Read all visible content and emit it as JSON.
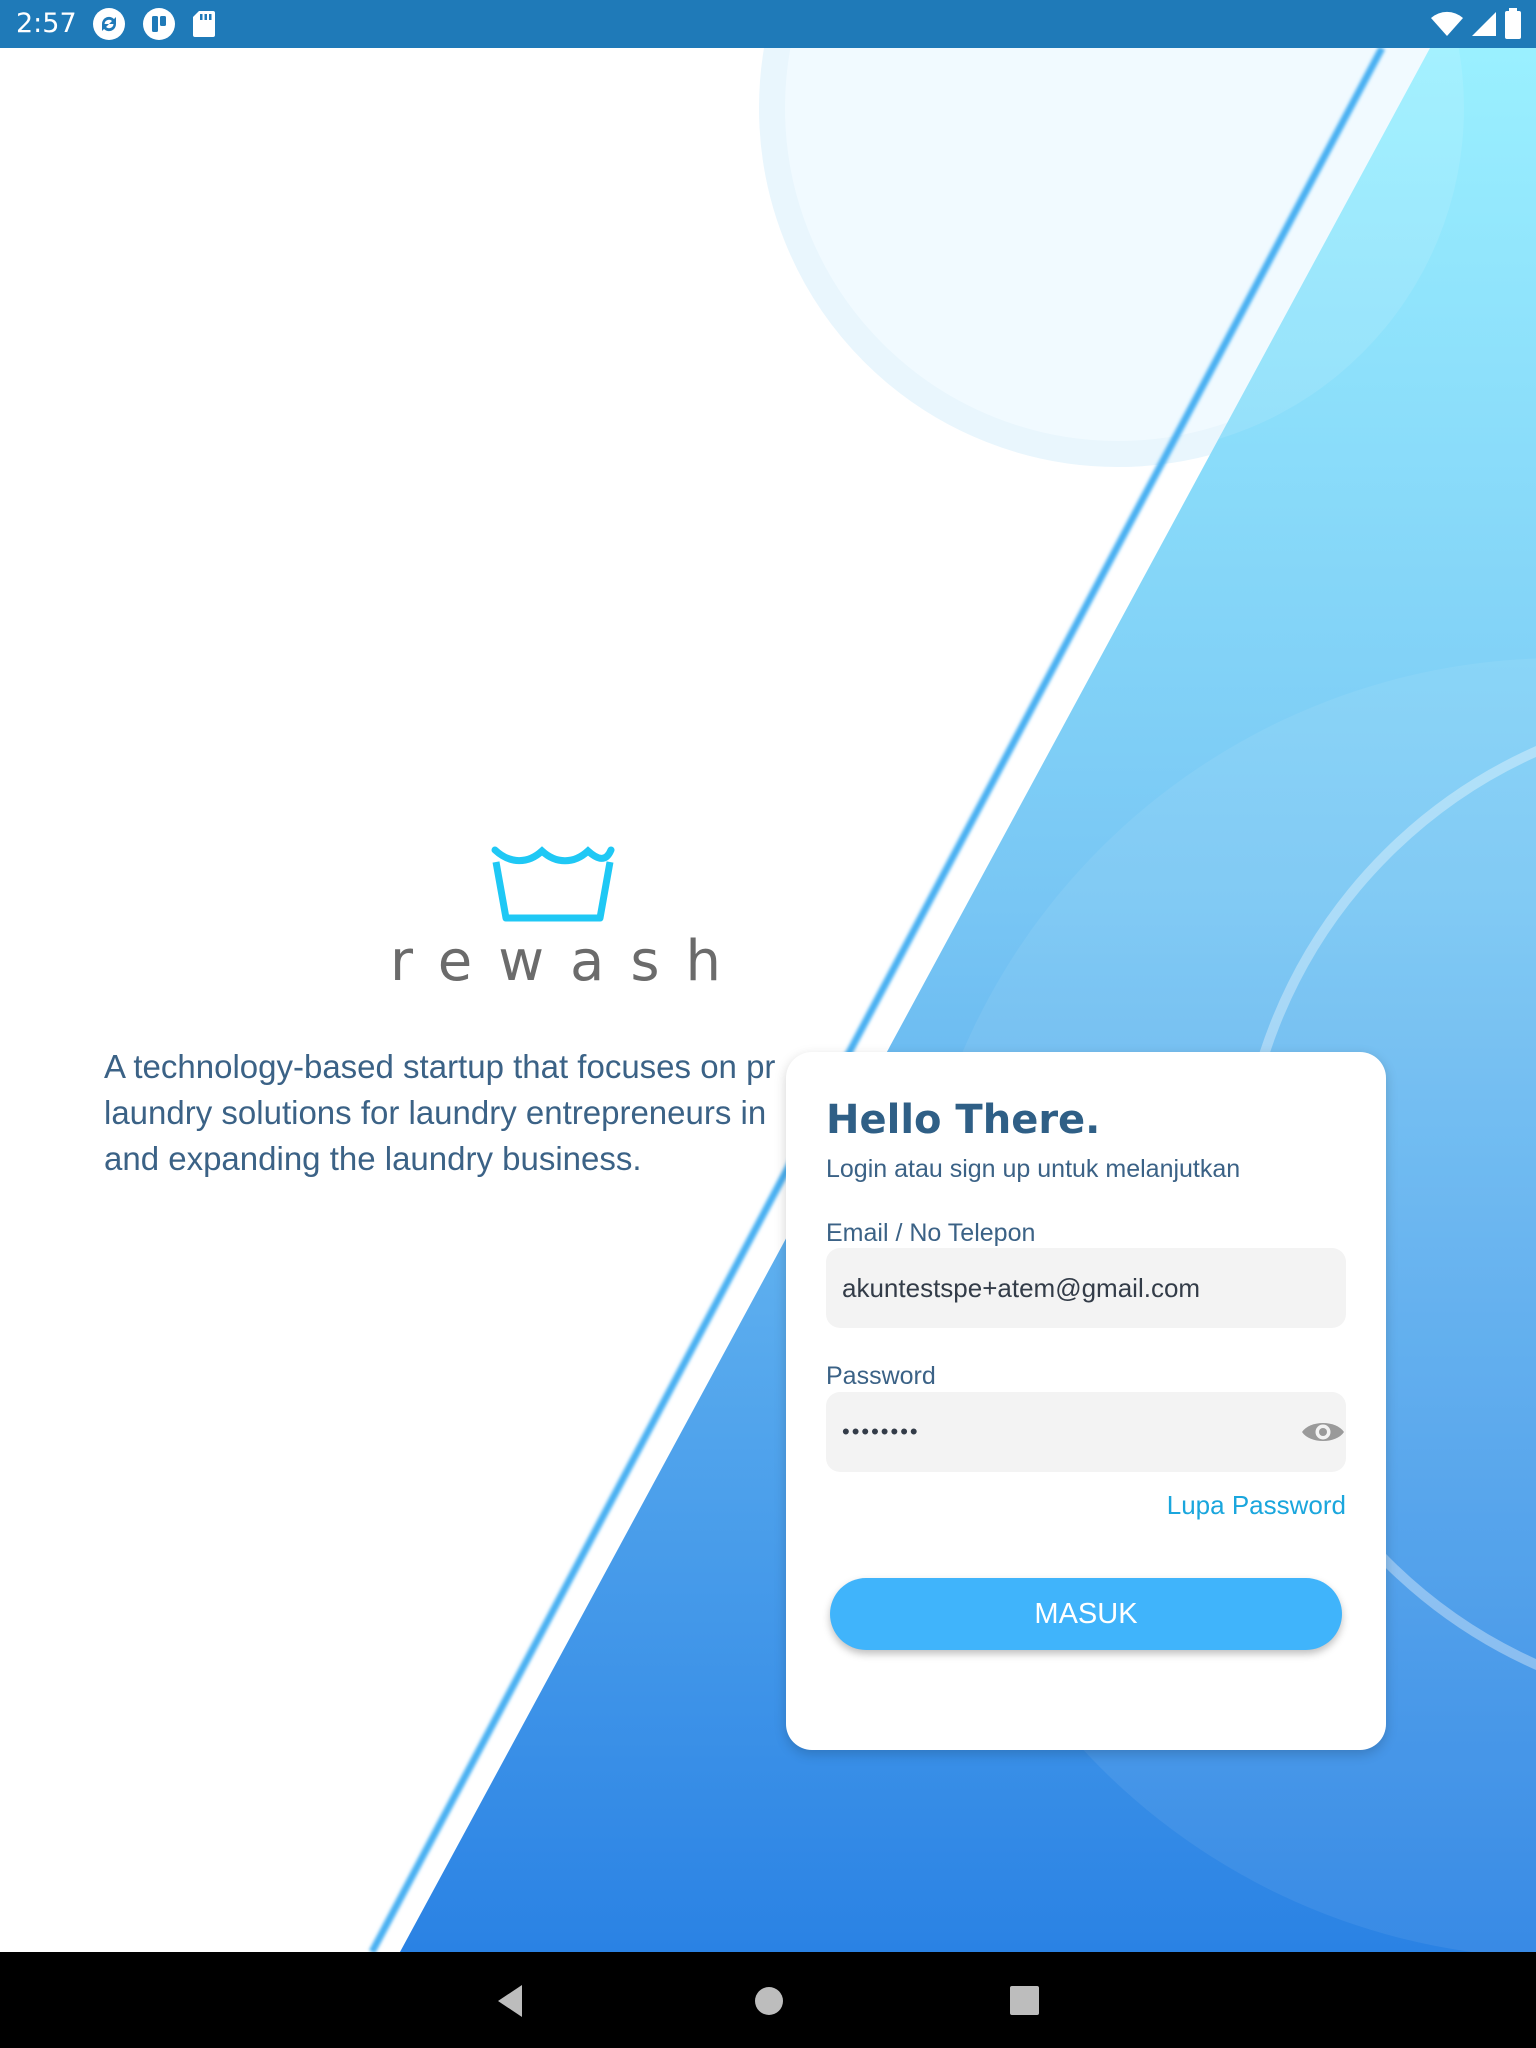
{
  "status_bar": {
    "time": "2:57",
    "left_icons": [
      "sync-icon",
      "app-notification-icon",
      "sd-card-icon"
    ],
    "right_icons": [
      "wifi-icon",
      "cell-signal-icon",
      "battery-icon"
    ]
  },
  "brand": {
    "logo_text": "rewash",
    "logo_color": "#1fc8f5"
  },
  "description": {
    "line1": "A technology-based startup that focuses on pr",
    "line2": "laundry solutions for laundry entrepreneurs in",
    "line3": "and expanding the laundry business."
  },
  "login": {
    "title": "Hello There.",
    "subtitle": "Login atau sign up untuk melanjutkan",
    "email_label": "Email / No Telepon",
    "email_value": "akuntestspe+atem@gmail.com",
    "password_label": "Password",
    "password_value": "••••••••",
    "forgot_label": "Lupa Password",
    "submit_label": "MASUK"
  },
  "nav_bar": {
    "buttons": [
      "back-icon",
      "home-icon",
      "recents-icon"
    ]
  },
  "colors": {
    "status_bar": "#1f7ab8",
    "title_text": "#2f5f86",
    "body_text": "#3b6286",
    "accent": "#40b4fb",
    "link": "#1aa6dd",
    "gradient_top": "#9af0ff",
    "gradient_bottom": "#2a82e4"
  }
}
